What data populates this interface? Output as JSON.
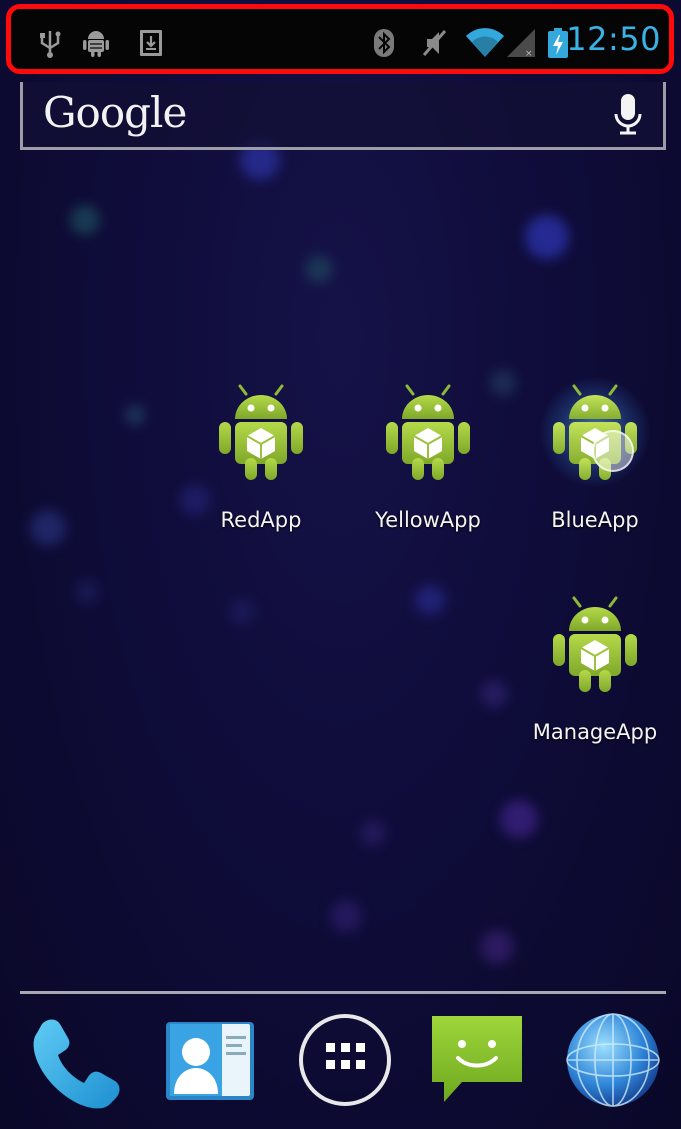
{
  "status_bar": {
    "left_icons": [
      "usb-icon",
      "android-debug-icon",
      "download-icon"
    ],
    "right_icons": [
      "bluetooth-icon",
      "muted-icon",
      "wifi-icon",
      "signal-icon",
      "battery-charging-icon"
    ],
    "time": "12:50",
    "accent_color": "#39b3e6"
  },
  "search": {
    "label": "Google",
    "icon": "mic-icon"
  },
  "apps": [
    {
      "label": "RedApp"
    },
    {
      "label": "YellowApp"
    },
    {
      "label": "BlueApp"
    },
    {
      "label": "ManageApp"
    }
  ],
  "dock": {
    "items": [
      "phone-icon",
      "contacts-icon",
      "app-drawer-icon",
      "messaging-icon",
      "browser-icon"
    ]
  }
}
